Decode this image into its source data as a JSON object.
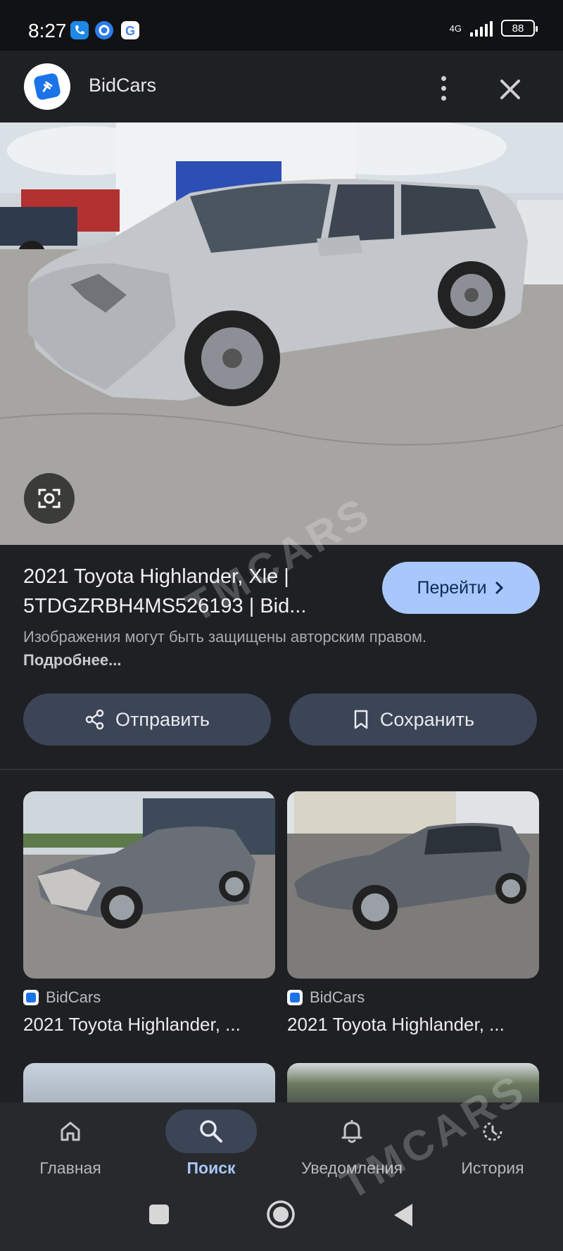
{
  "status_bar": {
    "time": "8:27",
    "network": "4G",
    "battery": "88"
  },
  "header": {
    "site_name": "BidCars",
    "brand_color": "#1a73e8"
  },
  "result": {
    "title": "2021 Toyota Highlander, Xle | 5TDGZRBH4MS526193 | Bid...",
    "visit_button": "Перейти",
    "copyright_text": "Изображения могут быть защищены авторским правом.",
    "copyright_link": "Подробнее..."
  },
  "actions": {
    "share_label": "Отправить",
    "save_label": "Сохранить"
  },
  "related": [
    {
      "source": "BidCars",
      "title": "2021 Toyota Highlander, ..."
    },
    {
      "source": "BidCars",
      "title": "2021 Toyota Highlander, ..."
    }
  ],
  "bottom_nav": [
    {
      "label": "Главная",
      "icon": "home-icon",
      "active": false
    },
    {
      "label": "Поиск",
      "icon": "search-icon",
      "active": true
    },
    {
      "label": "Уведомления",
      "icon": "bell-icon",
      "active": false
    },
    {
      "label": "История",
      "icon": "history-icon",
      "active": false
    }
  ],
  "watermark": "TMCARS",
  "accent_color": "#a8c7fa"
}
